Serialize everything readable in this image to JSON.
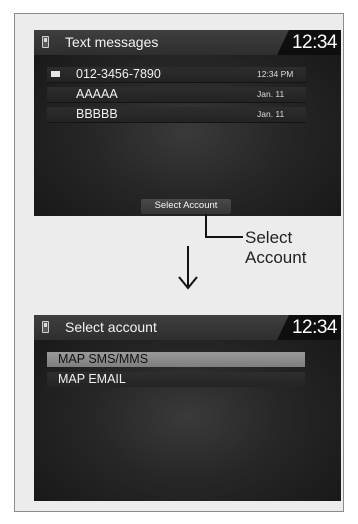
{
  "screen1": {
    "title": "Text messages",
    "time": "12:34",
    "messages": [
      {
        "sender": "012-3456-7890",
        "date": "12:34 PM",
        "unread_icon": "envelope-icon"
      },
      {
        "sender": "AAAAA",
        "date": "Jan. 11"
      },
      {
        "sender": "BBBBB",
        "date": "Jan. 11"
      }
    ],
    "softkey": "Select Account"
  },
  "callout": {
    "line1": "Select",
    "line2": "Account"
  },
  "screen2": {
    "title": "Select account",
    "time": "12:34",
    "items": [
      "MAP SMS/MMS",
      "MAP EMAIL"
    ],
    "selected_index": 0
  }
}
